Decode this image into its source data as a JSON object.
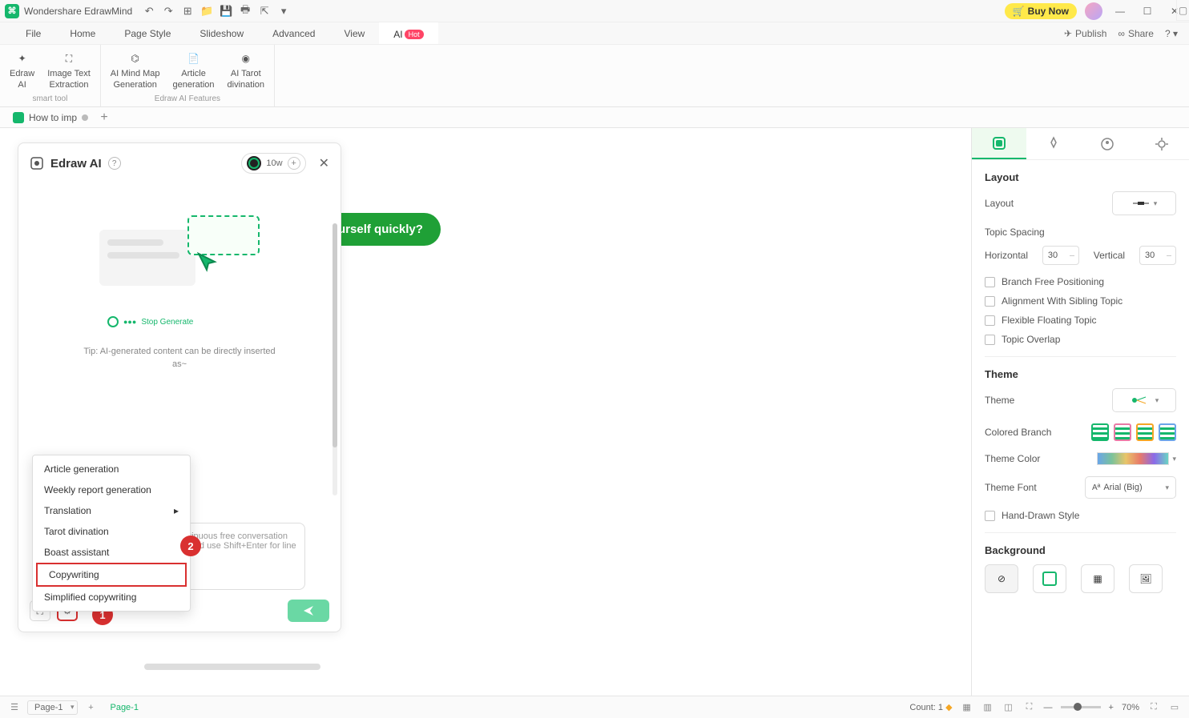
{
  "app": {
    "title": "Wondershare EdrawMind",
    "buy": "Buy Now"
  },
  "menu": {
    "items": [
      "File",
      "Home",
      "Page Style",
      "Slideshow",
      "Advanced",
      "View"
    ],
    "ai": "AI",
    "hot": "Hot",
    "publish": "Publish",
    "share": "Share"
  },
  "ribbon": {
    "smart": [
      {
        "label1": "Edraw",
        "label2": "AI"
      },
      {
        "label1": "Image Text",
        "label2": "Extraction"
      }
    ],
    "smart_label": "smart tool",
    "features": [
      {
        "label1": "AI Mind Map",
        "label2": "Generation"
      },
      {
        "label1": "Article",
        "label2": "generation"
      },
      {
        "label1": "AI Tarot",
        "label2": "divination"
      }
    ],
    "features_label": "Edraw AI Features"
  },
  "doc_tab": "How to imp",
  "canvas": {
    "node_text": "improve yourself quickly?"
  },
  "ai_panel": {
    "title": "Edraw AI",
    "token": "10w",
    "stop": "Stop Generate",
    "tip1": "Tip: AI-generated content can be directly inserted",
    "tip2": "as~",
    "input_ph1": "continuous free conversation",
    "input_ph2": "ge, and use Shift+Enter for line",
    "badge1": "1",
    "badge2": "2"
  },
  "ctx": {
    "items": [
      "Article generation",
      "Weekly report generation",
      "Translation",
      "Tarot divination",
      "Boast assistant",
      "Copywriting",
      "Simplified copywriting"
    ]
  },
  "rpanel": {
    "layout_h": "Layout",
    "layout_lbl": "Layout",
    "spacing_h": "Topic Spacing",
    "horiz": "Horizontal",
    "horiz_v": "30",
    "vert": "Vertical",
    "vert_v": "30",
    "chk1": "Branch Free Positioning",
    "chk2": "Alignment With Sibling Topic",
    "chk3": "Flexible Floating Topic",
    "chk4": "Topic Overlap",
    "theme_h": "Theme",
    "theme_lbl": "Theme",
    "cb_lbl": "Colored Branch",
    "tc_lbl": "Theme Color",
    "tf_lbl": "Theme Font",
    "tf_val": "Arial (Big)",
    "hd_lbl": "Hand-Drawn Style",
    "bg_h": "Background"
  },
  "status": {
    "page_sel": "Page-1",
    "page_tab": "Page-1",
    "count": "Count: 1",
    "zoom": "70%"
  }
}
